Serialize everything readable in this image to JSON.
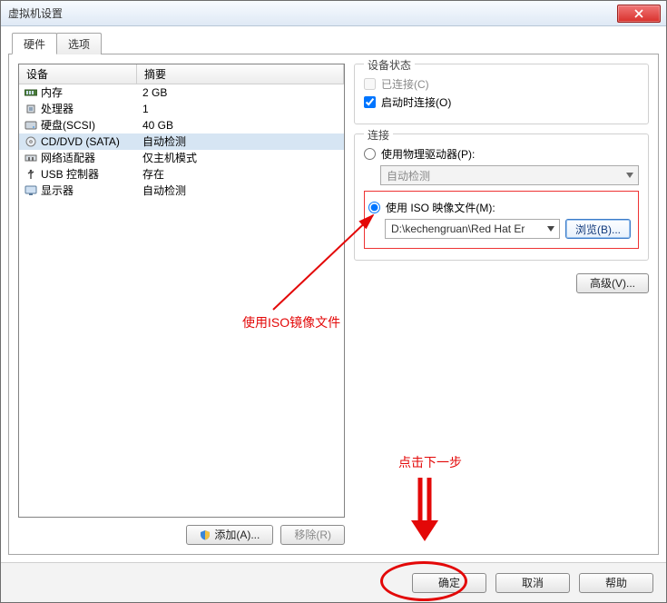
{
  "window": {
    "title": "虚拟机设置"
  },
  "tabs": {
    "hardware": "硬件",
    "options": "选项"
  },
  "deviceHeader": {
    "device": "设备",
    "summary": "摘要"
  },
  "devices": [
    {
      "name": "内存",
      "summary": "2 GB",
      "icon": "memory"
    },
    {
      "name": "处理器",
      "summary": "1",
      "icon": "cpu"
    },
    {
      "name": "硬盘(SCSI)",
      "summary": "40 GB",
      "icon": "disk"
    },
    {
      "name": "CD/DVD (SATA)",
      "summary": "自动检测",
      "icon": "cd",
      "selected": true
    },
    {
      "name": "网络适配器",
      "summary": "仅主机模式",
      "icon": "net"
    },
    {
      "name": "USB 控制器",
      "summary": "存在",
      "icon": "usb"
    },
    {
      "name": "显示器",
      "summary": "自动检测",
      "icon": "display"
    }
  ],
  "leftButtons": {
    "add": "添加(A)...",
    "remove": "移除(R)"
  },
  "status": {
    "legend": "设备状态",
    "connected": "已连接(C)",
    "connectOnStart": "启动时连接(O)"
  },
  "connection": {
    "legend": "连接",
    "physical": "使用物理驱动器(P):",
    "autoDetect": "自动检测",
    "iso": "使用 ISO 映像文件(M):",
    "isoPath": "D:\\kechengruan\\Red Hat Er",
    "browse": "浏览(B)..."
  },
  "advanced": "高级(V)...",
  "bottom": {
    "ok": "确定",
    "cancel": "取消",
    "help": "帮助"
  },
  "annot": {
    "iso": "使用ISO镜像文件",
    "next": "点击下一步"
  }
}
